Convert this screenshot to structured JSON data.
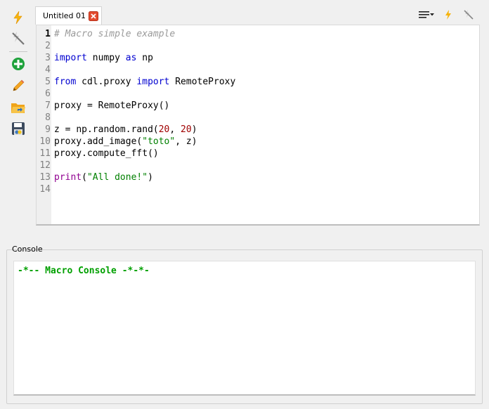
{
  "toolbar": {
    "items": [
      {
        "icon": "run-macro-icon"
      },
      {
        "icon": "stop-macro-icon"
      },
      {
        "icon": "new-macro-icon"
      },
      {
        "icon": "rename-macro-icon"
      },
      {
        "icon": "import-macro-icon"
      },
      {
        "icon": "export-macro-icon"
      }
    ]
  },
  "tabs": [
    {
      "label": "Untitled 01",
      "active": true
    }
  ],
  "top_right_icons": [
    "menu-icon",
    "run-icon",
    "stop-icon"
  ],
  "editor": {
    "current_line": 1,
    "line_numbers": [
      "1",
      "2",
      "3",
      "4",
      "5",
      "6",
      "7",
      "8",
      "9",
      "10",
      "11",
      "12",
      "13",
      "14"
    ],
    "lines": [
      "# Macro simple example",
      "",
      "import numpy as np",
      "",
      "from cdl.proxy import RemoteProxy",
      "",
      "proxy = RemoteProxy()",
      "",
      "z = np.random.rand(20, 20)",
      "proxy.add_image(\"toto\", z)",
      "proxy.compute_fft()",
      "",
      "print(\"All done!\")",
      ""
    ]
  },
  "console": {
    "label": "Console",
    "text": "-*-- Macro Console -*-*-"
  },
  "colors": {
    "keyword": "#0000d0",
    "number": "#a00000",
    "string": "#008000",
    "comment": "#9a9a9a",
    "builtin": "#900090",
    "console_text": "#00a000"
  }
}
